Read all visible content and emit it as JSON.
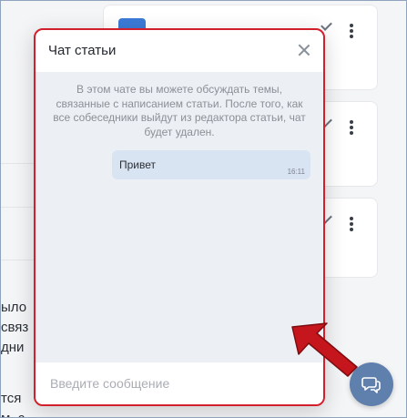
{
  "background": {
    "body_lines": [
      "ыло",
      "связ",
      "дни",
      "тся",
      "м. с"
    ]
  },
  "chat": {
    "title": "Чат статьи",
    "system_message": "В этом чате вы можете обсуждать темы, связанные с написанием статьи. После того, как все собеседники выйдут из редактора статьи, чат будет удален.",
    "messages": [
      {
        "text": "Привет",
        "time": "16:11"
      }
    ],
    "input_placeholder": "Введите сообщение"
  },
  "icons": {
    "close": "close-icon",
    "fab": "chat-bubbles-icon",
    "kebab": "kebab-menu-icon",
    "check": "check-icon"
  },
  "colors": {
    "highlight_border": "#d21f2b",
    "fab": "#5f7fad",
    "bubble": "#d9e4f3",
    "arrow": "#c4161c"
  }
}
